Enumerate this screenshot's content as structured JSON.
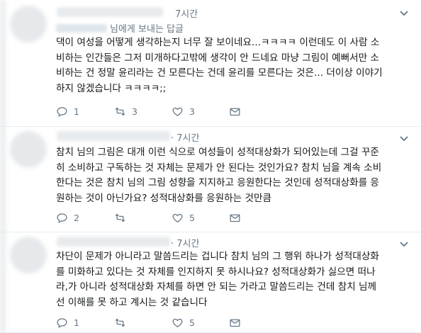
{
  "tweets": [
    {
      "time": "7시간",
      "reply_suffix": "님에게 보내는 답글",
      "text": "댁이 여성을 어떻게 생각하는지 너무 잘 보이네요...ㅋㅋㅋㅋ 이런데도 이 사람 소\n비하는 인간들은 그저 미개하다고밖에 생각이 안 드네요 마냥 그림이 예뻐서만 소\n비하는 건 정말 윤리라는 건 모른다는 건데 윤리를 모른다는 것은... 더이상 이야기\n하지 않겠습니다 ㅋㅋㅋㅋ;;",
      "replies": "1",
      "retweets": "3",
      "likes": "3"
    },
    {
      "time": "· 7시간",
      "text": "참치 님의 그림은 대개 이런 식으로 여성들이 성적대상화가 되어있는데 그걸 꾸준\n히 소비하고 구독하는 것 자체는 문제가 안 된다는 것인가요? 참치 님을 계속 소비\n한다는 것은 참치 님의 그림 성향을 지지하고 응원한다는 것인데 성적대상화를 응\n원하는 것이 아닌가요? 성적대상화를 응원하는 것만큼",
      "replies": "2",
      "retweets": "",
      "likes": "5"
    },
    {
      "time": "· 7시간",
      "text": "차단이 문제가 아니라고 말씀드리는 겁니다 참치 님의 그 행위 하나가 성적대상화\n를 미화하고 있다는 것 자체를 인지하지 못 하시나요? 성적대상화가 싫으면 떠나\n라,가 아니라 성적대상화 자체를 하면 안 되는 가라고 말씀드리는 건데 참치 님께\n선 이해를 못 하고 계시는 것 같습니다",
      "replies": "1",
      "retweets": "",
      "likes": "5"
    }
  ],
  "icons": {
    "reply": "reply-icon",
    "retweet": "retweet-icon",
    "like": "heart-icon",
    "dm": "envelope-icon",
    "menu": "chevron-down-icon"
  },
  "colors": {
    "text": "#14171a",
    "muted": "#657786",
    "link": "#1da1f2",
    "divider": "#e6ecf0"
  }
}
